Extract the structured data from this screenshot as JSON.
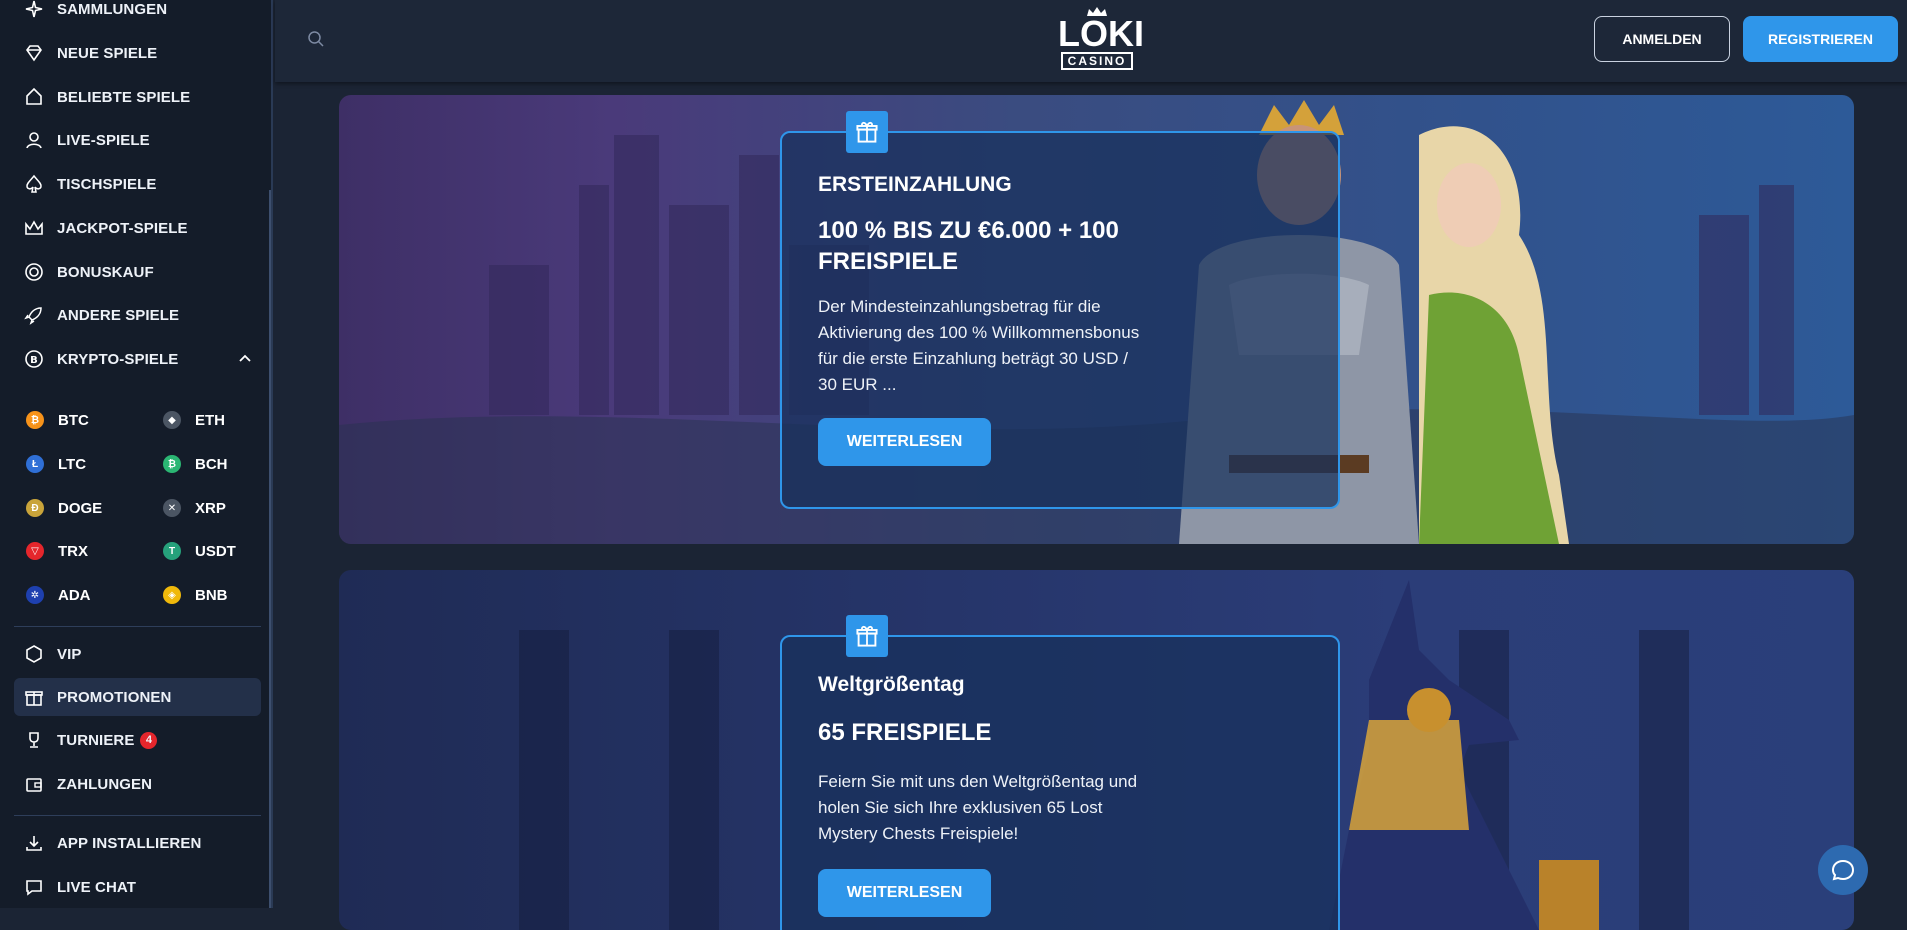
{
  "sidebar": {
    "items": [
      {
        "label": "SAMMLUNGEN",
        "icon": "sparkle-icon"
      },
      {
        "label": "NEUE SPIELE",
        "icon": "diamond-icon"
      },
      {
        "label": "BELIEBTE SPIELE",
        "icon": "home-star-icon"
      },
      {
        "label": "LIVE-SPIELE",
        "icon": "dealer-icon"
      },
      {
        "label": "TISCHSPIELE",
        "icon": "spade-icon"
      },
      {
        "label": "JACKPOT-SPIELE",
        "icon": "crown-icon"
      },
      {
        "label": "BONUSKAUF",
        "icon": "target-icon"
      },
      {
        "label": "ANDERE SPIELE",
        "icon": "rocket-icon"
      },
      {
        "label": "KRYPTO-SPIELE",
        "icon": "bitcoin-circle-icon"
      }
    ],
    "coins": [
      {
        "label": "BTC",
        "color": "#f7931a",
        "glyph": "₿"
      },
      {
        "label": "ETH",
        "color": "#6b7280",
        "glyph": "◆"
      },
      {
        "label": "LTC",
        "color": "#2f6fd6",
        "glyph": "Ł"
      },
      {
        "label": "BCH",
        "color": "#2bb673",
        "glyph": "₿"
      },
      {
        "label": "DOGE",
        "color": "#c9a43a",
        "glyph": "Ð"
      },
      {
        "label": "XRP",
        "color": "#4b5563",
        "glyph": "✕"
      },
      {
        "label": "TRX",
        "color": "#e5262c",
        "glyph": "▽"
      },
      {
        "label": "USDT",
        "color": "#26a17b",
        "glyph": "T"
      },
      {
        "label": "ADA",
        "color": "#1e40af",
        "glyph": "✲"
      },
      {
        "label": "BNB",
        "color": "#f0b90b",
        "glyph": "◈"
      }
    ],
    "bottom_items": [
      {
        "label": "VIP",
        "icon": "vip-shield-icon"
      },
      {
        "label": "PROMOTIONEN",
        "icon": "gift-icon"
      },
      {
        "label": "TURNIERE",
        "icon": "trophy-icon",
        "badge": "4"
      },
      {
        "label": "ZAHLUNGEN",
        "icon": "wallet-icon"
      }
    ],
    "footer_items": [
      {
        "label": "APP INSTALLIEREN",
        "icon": "download-icon"
      },
      {
        "label": "LIVE CHAT",
        "icon": "chat-icon"
      }
    ]
  },
  "header": {
    "logo_main": "LOKI",
    "logo_sub": "CASINO",
    "login_label": "ANMELDEN",
    "register_label": "REGISTRIEREN"
  },
  "promos": [
    {
      "title": "ERSTEINZAHLUNG",
      "headline": "100 % BIS ZU €6.000 + 100 FREISPIELE",
      "description": "Der Mindesteinzahlungsbetrag für die Aktivierung des 100 % Willkommensbonus für die erste Einzahlung beträgt 30 USD / 30 EUR ...",
      "button": "WEITERLESEN"
    },
    {
      "title": "Weltgrößentag",
      "headline": "65 FREISPIELE",
      "description": "Feiern Sie mit uns den Weltgrößentag und holen Sie sich Ihre exklusiven 65 Lost Mystery Chests Freispiele!",
      "button": "WEITERLESEN"
    }
  ],
  "colors": {
    "accent": "#2f96ea",
    "sidebar_bg": "#141c29",
    "header_bg": "#1d2738",
    "badge": "#e5262c"
  }
}
